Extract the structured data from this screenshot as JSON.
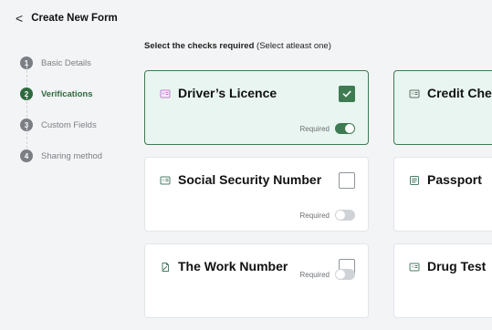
{
  "topbar": {
    "back_glyph": "<",
    "title": "Create New Form"
  },
  "sidebar": {
    "steps": [
      {
        "num": "1",
        "label": "Basic Details",
        "active": false
      },
      {
        "num": "2",
        "label": "Verifications",
        "active": true
      },
      {
        "num": "3",
        "label": "Custom Fields",
        "active": false
      },
      {
        "num": "4",
        "label": "Sharing method",
        "active": false
      }
    ]
  },
  "main": {
    "instruction_strong": "Select the checks required",
    "instruction_rest": " (Select atleast one)",
    "cards": [
      {
        "title": "Driver’s Licence",
        "icon": "id-card-icon",
        "checked": true,
        "required_label": "Required",
        "required_on": true
      },
      {
        "title": "Credit Chec",
        "icon": "id-card-icon",
        "checked": false,
        "required_label": "",
        "required_on": false
      },
      {
        "title": "Social Security Number",
        "icon": "id-card-icon",
        "checked": false,
        "required_label": "Required",
        "required_on": false
      },
      {
        "title": "Passport",
        "icon": "passport-icon",
        "checked": false,
        "required_label": "",
        "required_on": false
      },
      {
        "title": "The Work Number",
        "icon": "document-edit-icon",
        "checked": false,
        "required_label": "Required",
        "required_on": false
      },
      {
        "title": "Drug Test",
        "icon": "id-card-icon",
        "checked": false,
        "required_label": "",
        "required_on": false
      }
    ]
  },
  "colors": {
    "accent_green": "#3e7b52",
    "selected_bg": "#e9f5f0",
    "muted_text": "#7b7f85"
  }
}
